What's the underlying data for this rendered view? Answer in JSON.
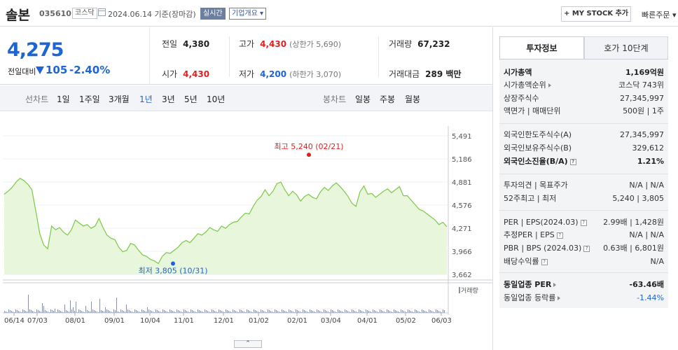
{
  "header": {
    "company_name": "솔본",
    "code": "035610",
    "market": "코스닥",
    "date_text": "2024.06.14 기준(장마감)",
    "realtime_label": "실시간",
    "overview_label": "기업개요",
    "mystock_label": "+ MY STOCK 추가",
    "quick_order_label": "빠른주문"
  },
  "price": {
    "current": "4,275",
    "change_label": "전일대비",
    "change_value": "105",
    "change_pct": "-2.40%"
  },
  "stats": {
    "prev_label": "전일",
    "prev": "4,380",
    "high_label": "고가",
    "high": "4,430",
    "upper_limit": "(상한가 5,690)",
    "volume_label": "거래량",
    "volume": "67,232",
    "open_label": "시가",
    "open": "4,430",
    "low_label": "저가",
    "low": "4,200",
    "lower_limit": "(하한가 3,070)",
    "amount_label": "거래대금",
    "amount": "289 백만"
  },
  "period_tabs": {
    "line_label": "선차트",
    "items": [
      "1일",
      "1주일",
      "3개월",
      "1년",
      "3년",
      "5년",
      "10년"
    ],
    "selected": "1년",
    "candle_label": "봉차트",
    "candle_items": [
      "일봉",
      "주봉",
      "월봉"
    ]
  },
  "chart_data": {
    "type": "area",
    "ylim": [
      3662,
      5491
    ],
    "yticks": [
      "5,491",
      "5,186",
      "4,881",
      "4,576",
      "4,271",
      "3,966",
      "3,662"
    ],
    "xticks": [
      "06/14",
      "07/03",
      "08/01",
      "09/01",
      "10/04",
      "11/01",
      "12/01",
      "01/02",
      "02/01",
      "03/04",
      "04/01",
      "05/02",
      "06/03"
    ],
    "max_annotation": "최고 5,240 (02/21)",
    "min_annotation": "최저 3,805 (10/31)",
    "volume_legend": "거래량",
    "price_series": [
      4720,
      4760,
      4810,
      4880,
      4930,
      4900,
      4850,
      4780,
      4500,
      4200,
      4050,
      4000,
      4300,
      4250,
      4280,
      4220,
      4180,
      4250,
      4380,
      4340,
      4300,
      4320,
      4270,
      4300,
      4400,
      4280,
      4180,
      4140,
      4120,
      4020,
      3960,
      3980,
      4070,
      4050,
      3980,
      3920,
      3900,
      3860,
      3840,
      3805,
      3900,
      3950,
      3940,
      3980,
      4020,
      4080,
      4110,
      4080,
      4140,
      4200,
      4180,
      4220,
      4280,
      4250,
      4230,
      4300,
      4270,
      4320,
      4350,
      4360,
      4420,
      4470,
      4460,
      4560,
      4640,
      4690,
      4780,
      4700,
      4760,
      4860,
      4880,
      4780,
      4700,
      4760,
      4710,
      4630,
      4690,
      4720,
      4680,
      4660,
      4750,
      4810,
      4770,
      4830,
      4870,
      4820,
      4760,
      4690,
      4600,
      4560,
      4750,
      4830,
      4720,
      4730,
      4680,
      4720,
      4760,
      4790,
      4740,
      4780,
      4820,
      4700,
      4700,
      4640,
      4580,
      4520,
      4500,
      4460,
      4420,
      4380,
      4320,
      4350,
      4290
    ]
  },
  "right_panel": {
    "tabs": [
      "투자정보",
      "호가 10단계"
    ],
    "rows": [
      {
        "k": "시가총액",
        "v": "1,169억원",
        "bold": true
      },
      {
        "k": "시가총액순위",
        "v": "코스닥 743위"
      },
      {
        "k": "상장주식수",
        "v": "27,345,997"
      },
      {
        "k": "액면가 | 매매단위",
        "v": "500원 | 1주"
      },
      {
        "k": "외국인한도주식수(A)",
        "v": "27,345,997"
      },
      {
        "k": "외국인보유주식수(B)",
        "v": "329,612"
      },
      {
        "k": "외국인소진율(B/A)",
        "v": "1.21%",
        "bold": true
      },
      {
        "k": "투자의견 | 목표주가",
        "v": "N/A | N/A"
      },
      {
        "k": "52주최고 | 최저",
        "v": "5,240 | 3,805"
      },
      {
        "k": "PER | EPS(2024.03)",
        "v": "2.99배 | 1,428원"
      },
      {
        "k": "추정PER | EPS",
        "v": "N/A | N/A"
      },
      {
        "k": "PBR | BPS (2024.03)",
        "v": "0.63배 | 6,801원"
      },
      {
        "k": "배당수익률",
        "v": "N/A"
      },
      {
        "k": "동일업종 PER",
        "v": "-63.46배",
        "bold": true
      },
      {
        "k": "동일업종 등락률",
        "v": "-1.44%"
      }
    ]
  },
  "colors": {
    "accent_blue": "#1e64d2",
    "red": "#e02020",
    "chart_line": "#7ac943",
    "chart_fill": "#e6f5d9"
  }
}
